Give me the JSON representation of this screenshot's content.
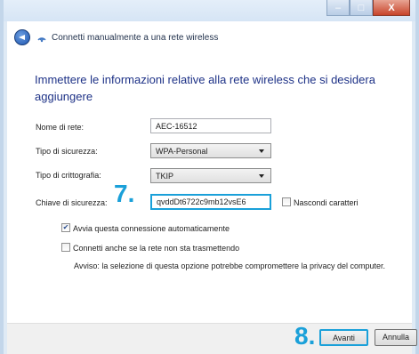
{
  "window": {
    "header_title": "Connetti manualmente a una rete wireless",
    "controls": {
      "minimize": "‒",
      "maximize": "□",
      "close": "X"
    }
  },
  "main": {
    "heading": "Immettere le informazioni relative alla rete wireless che si desidera aggiungere",
    "network_name": {
      "label": "Nome di rete:",
      "value": "AEC-16512"
    },
    "security_type": {
      "label": "Tipo di sicurezza:",
      "value": "WPA-Personal"
    },
    "encryption_type": {
      "label": "Tipo di crittografia:",
      "value": "TKIP"
    },
    "security_key": {
      "label": "Chiave di sicurezza:",
      "value": "qvddDt6722c9mb12vsE6"
    },
    "hide_chars": {
      "label": "Nascondi caratteri",
      "checked": false
    },
    "auto_connect": {
      "label": "Avvia questa connessione automaticamente",
      "checked": true
    },
    "connect_hidden": {
      "label": "Connetti anche se la rete non sta trasmettendo",
      "checked": false
    },
    "warning": "Avviso: la selezione di questa opzione potrebbe compromettere la privacy del computer."
  },
  "annotations": {
    "step7": "7.",
    "step8": "8."
  },
  "buttons": {
    "next": "Avanti",
    "cancel": "Annulla"
  },
  "colors": {
    "accent": "#1aa0d9",
    "heading": "#1e3287"
  }
}
